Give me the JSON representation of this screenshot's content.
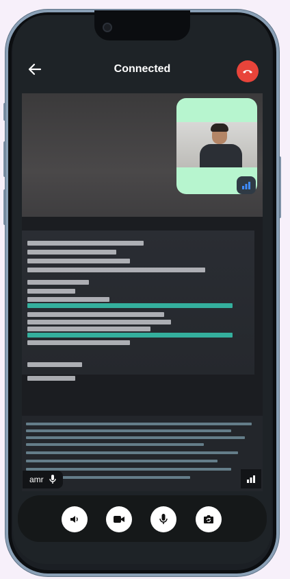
{
  "header": {
    "title": "Connected"
  },
  "icons": {
    "back": "arrow-left-icon",
    "end_call": "phone-hangup-icon",
    "mic": "mic-icon",
    "signal": "signal-bars-icon",
    "speaker": "volume-icon",
    "video": "video-camera-icon",
    "microphone": "microphone-icon",
    "switch_camera": "switch-camera-icon"
  },
  "participant": {
    "name": "amr"
  },
  "colors": {
    "background": "#f7f0fa",
    "screen": "#1e2327",
    "end_call": "#e8443a",
    "pip_background": "#b7f5cf",
    "signal_active": "#3f8cff",
    "control_bar": "#151819",
    "control_button": "#ffffff"
  }
}
